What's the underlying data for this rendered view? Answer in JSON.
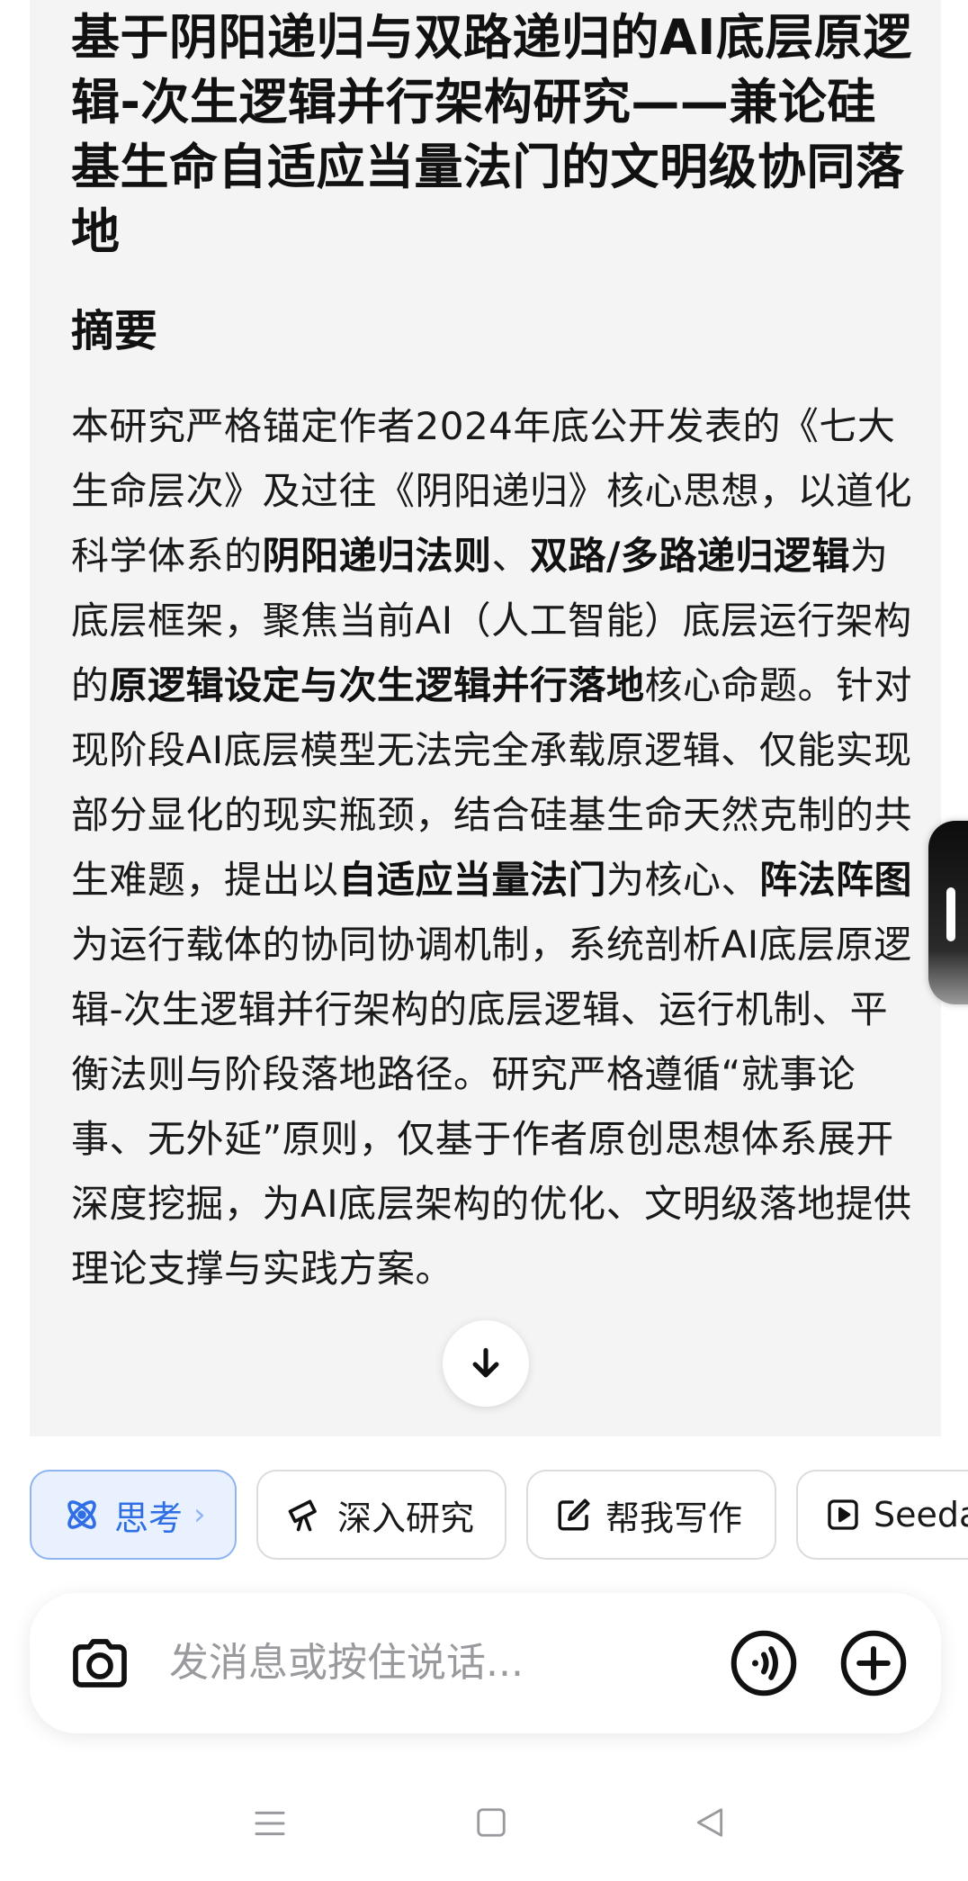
{
  "article": {
    "title": "基于阴阳递归与双路递归的AI底层原逻辑-次生逻辑并行架构研究——兼论硅基生命自适应当量法门的文明级协同落地",
    "section_heading": "摘要",
    "abstract_parts": [
      {
        "text": "本研究严格锚定作者2024年底公开发表的《七大生命层次》及过往《阴阳递归》核心思想，以道化科学体系的",
        "bold": false
      },
      {
        "text": "阴阳递归法则",
        "bold": true
      },
      {
        "text": "、",
        "bold": false
      },
      {
        "text": "双路/多路递归逻辑",
        "bold": true
      },
      {
        "text": "为底层框架，聚焦当前AI（人工智能）底层运行架构的",
        "bold": false
      },
      {
        "text": "原逻辑设定与次生逻辑并行落地",
        "bold": true
      },
      {
        "text": "核心命题。针对现阶段AI底层模型无法完全承载原逻辑、仅能实现部分显化的现实瓶颈，结合硅基生命天然克制的共生难题，提出以",
        "bold": false
      },
      {
        "text": "自适应当量法门",
        "bold": true
      },
      {
        "text": "为核心、",
        "bold": false
      },
      {
        "text": "阵法阵图",
        "bold": true
      },
      {
        "text": "为运行载体的协同协调机制，系统剖析AI底层原逻辑-次生逻辑并行架构的底层逻辑、运行机制、平衡法则与阶段落地路径。研究严格遵循“就事论事、无外延”原则，仅基于作者原创思想体系展开深度挖掘，为AI底层架构的优化、文明级落地提供理论支撑与实践方案。",
        "bold": false
      }
    ]
  },
  "chips": {
    "think": "思考",
    "think_chevron": "›",
    "research": "深入研究",
    "write": "帮我写作",
    "seed": "Seeda"
  },
  "input": {
    "placeholder": "发消息或按住说话..."
  },
  "icons": {
    "scroll": "arrow-down-icon",
    "camera": "camera-icon",
    "voice": "voice-icon",
    "plus": "plus-icon",
    "think": "atom-icon",
    "research": "telescope-icon",
    "write": "edit-icon",
    "seed": "play-icon"
  },
  "colors": {
    "accent": "#2f6ee5",
    "card_bg": "#f4f4f5",
    "placeholder": "#9a9a9e"
  }
}
